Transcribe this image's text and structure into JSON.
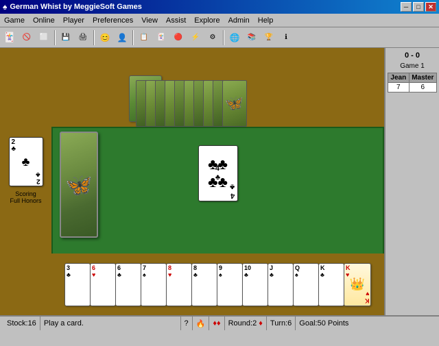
{
  "window": {
    "title": "German Whist by MeggieSoft Games",
    "title_icon": "♠"
  },
  "title_buttons": {
    "minimize": "─",
    "maximize": "□",
    "close": "✕"
  },
  "menu": {
    "items": [
      "Game",
      "Online",
      "Player",
      "Preferences",
      "View",
      "Assist",
      "Explore",
      "Admin",
      "Help"
    ]
  },
  "toolbar": {
    "buttons": [
      "🃏",
      "⛔",
      "⬜",
      "💾",
      "🖨",
      "✉",
      "⚙",
      "👤",
      "📋",
      "🃏",
      "⛔",
      "⚡",
      "🔧",
      "📊",
      "🌐",
      "📚",
      "🏆",
      "ℹ"
    ]
  },
  "score": {
    "header": "0 - 0",
    "game": "Game 1",
    "columns": [
      "Jean",
      "Master"
    ],
    "rows": [
      [
        "7",
        "6"
      ]
    ]
  },
  "player_card": {
    "rank": "2",
    "suit": "♣",
    "color": "black"
  },
  "scoring_label": "Scoring",
  "honors_label": "Full Honors",
  "center_card": {
    "rank": "4",
    "suit": "♣",
    "color": "black"
  },
  "player_hand": [
    {
      "rank": "3",
      "suit": "♣",
      "color": "black"
    },
    {
      "rank": "6",
      "suit": "♥",
      "color": "red"
    },
    {
      "rank": "6",
      "suit": "♣",
      "color": "black"
    },
    {
      "rank": "7",
      "suit": "♠",
      "color": "black"
    },
    {
      "rank": "8",
      "suit": "♥",
      "color": "red"
    },
    {
      "rank": "8",
      "suit": "♣",
      "color": "black"
    },
    {
      "rank": "9",
      "suit": "♠",
      "color": "black"
    },
    {
      "rank": "10",
      "suit": "♣",
      "color": "black"
    },
    {
      "rank": "J",
      "suit": "♣",
      "color": "black"
    },
    {
      "rank": "Q",
      "suit": "♠",
      "color": "black"
    },
    {
      "rank": "K",
      "suit": "♣",
      "color": "black"
    },
    {
      "rank": "K",
      "suit": "♥",
      "color": "red"
    }
  ],
  "status": {
    "stock": "Stock:16",
    "message": "Play a card.",
    "hint": "?",
    "fire": "🔥",
    "diamonds": "♦♦",
    "round": "Round:2",
    "round_suit": "♦",
    "turn": "Turn:6",
    "goal": "Goal:50 Points"
  }
}
